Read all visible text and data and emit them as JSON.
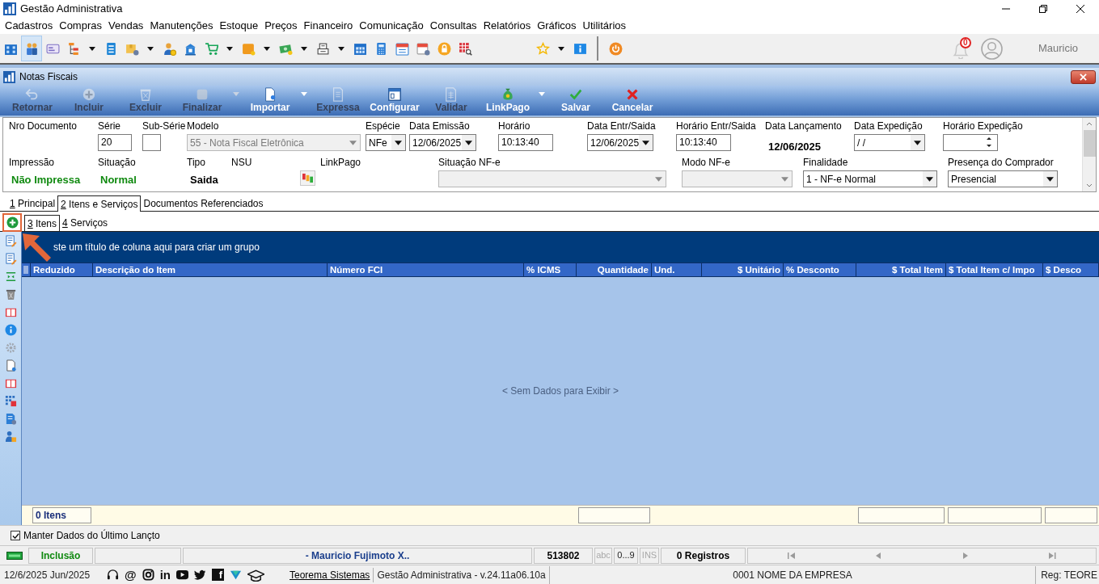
{
  "window": {
    "title": "Gestão Administrativa"
  },
  "menu": [
    "Cadastros",
    "Compras",
    "Vendas",
    "Manutenções",
    "Estoque",
    "Preços",
    "Financeiro",
    "Comunicação",
    "Consultas",
    "Relatórios",
    "Gráficos",
    "Utilitários"
  ],
  "quick_toolbar": [
    {
      "dropdown": false,
      "selected": false
    },
    {
      "dropdown": false,
      "selected": true
    },
    {
      "dropdown": false,
      "selected": false
    },
    {
      "dropdown": true,
      "selected": false
    },
    {
      "dropdown": false,
      "selected": false
    },
    {
      "dropdown": true,
      "selected": false
    },
    {
      "dropdown": false,
      "selected": false
    },
    {
      "dropdown": false,
      "selected": false
    },
    {
      "dropdown": true,
      "selected": false
    },
    {
      "dropdown": true,
      "selected": false
    },
    {
      "dropdown": true,
      "selected": false
    },
    {
      "dropdown": true,
      "selected": false
    },
    {
      "dropdown": false,
      "selected": false
    },
    {
      "dropdown": false,
      "selected": false
    },
    {
      "dropdown": false,
      "selected": false
    },
    {
      "dropdown": false,
      "selected": false
    },
    {
      "dropdown": false,
      "selected": false
    },
    {
      "dropdown": false,
      "selected": false
    },
    {
      "dropdown": true,
      "selected": false
    },
    {
      "dropdown": false,
      "selected": false
    },
    {
      "dropdown": false,
      "selected": false
    }
  ],
  "notifications": {
    "count": "0"
  },
  "user": {
    "name": "Mauricio"
  },
  "document_window": {
    "title": "Notas Fiscais",
    "actions": [
      {
        "label": "Retornar",
        "disabled": true,
        "dropdown": false
      },
      {
        "label": "Incluir",
        "disabled": true,
        "dropdown": false
      },
      {
        "label": "Excluir",
        "disabled": true,
        "dropdown": false
      },
      {
        "label": "Finalizar",
        "disabled": true,
        "dropdown": true
      },
      {
        "label": "Importar",
        "disabled": false,
        "dropdown": true
      },
      {
        "label": "Expressa",
        "disabled": true,
        "dropdown": false
      },
      {
        "label": "Configurar",
        "disabled": false,
        "dropdown": false
      },
      {
        "label": "Validar",
        "disabled": true,
        "dropdown": false
      },
      {
        "label": "LinkPago",
        "disabled": false,
        "dropdown": true
      },
      {
        "label": "Salvar",
        "disabled": false,
        "dropdown": false
      },
      {
        "label": "Cancelar",
        "disabled": false,
        "dropdown": false
      }
    ],
    "header_rows": [
      [
        {
          "label": "Nro Documento",
          "kind": "none"
        },
        {
          "label": "Série",
          "kind": "input",
          "value": "20"
        },
        {
          "label": "Sub-Série",
          "kind": "input"
        },
        {
          "label": "Modelo",
          "kind": "select",
          "value": "55 - Nota Fiscal Eletrônica",
          "disabled": true
        },
        {
          "label": "Espécie",
          "kind": "select",
          "value": "NFe",
          "disabled": false
        },
        {
          "label": "Data Emissão",
          "kind": "select",
          "value": "12/06/2025",
          "disabled": false
        },
        {
          "label": "Horário",
          "kind": "input",
          "value": "10:13:40"
        },
        {
          "label": "Data Entr/Saida",
          "kind": "select",
          "value": "12/06/2025",
          "disabled": false
        },
        {
          "label": "Horário Entr/Saida",
          "kind": "input",
          "value": "10:13:40"
        },
        {
          "label": "Data Lançamento",
          "kind": "text",
          "value": "12/06/2025"
        },
        {
          "label": "Data Expedição",
          "kind": "select",
          "value": "/ /",
          "disabled": false
        },
        {
          "label": "Horário Expedição",
          "kind": "spin"
        }
      ],
      [
        {
          "label": "Impressão",
          "kind": "status",
          "value": "Não Impressa"
        },
        {
          "label": "Situação",
          "kind": "status",
          "value": "Normal"
        },
        {
          "label": "Tipo",
          "kind": "text",
          "value": "Saida"
        },
        {
          "label": "NSU",
          "kind": "button"
        },
        {
          "label": "LinkPago",
          "kind": "none"
        },
        {
          "label": "Situação NF-e",
          "kind": "select",
          "disabled": true
        },
        {
          "label": "Modo NF-e",
          "kind": "select",
          "disabled": true
        },
        {
          "label": "Finalidade",
          "kind": "select",
          "value": "1 - NF-e Normal",
          "disabled": false
        },
        {
          "label": "Presença do Comprador",
          "kind": "select",
          "value": "Presencial",
          "disabled": false
        }
      ]
    ],
    "tabs": [
      {
        "key": "1",
        "label": "Principal",
        "selected": false
      },
      {
        "key": "2",
        "label": "Itens e Serviços",
        "selected": true
      },
      {
        "label": "Documentos Referenciados",
        "selected": false
      }
    ],
    "subtabs": [
      {
        "key": "3",
        "label": "Itens",
        "selected": true
      },
      {
        "key": "4",
        "label": "Serviços",
        "selected": false
      }
    ],
    "grid": {
      "group_hint": "ste um título de coluna aqui para criar um grupo",
      "columns": [
        {
          "title": "Reduzido",
          "summary": "0 Itens",
          "summary_box": true
        },
        {
          "title": "Descrição do Item",
          "summary_box": false
        },
        {
          "title": "Número FCI",
          "summary_box": false
        },
        {
          "title": "% ICMS",
          "summary_box": false
        },
        {
          "title": "Quantidade",
          "summary_box": true
        },
        {
          "title": "Und.",
          "summary_box": false
        },
        {
          "title": "$ Unitário",
          "summary_box": false
        },
        {
          "title": "% Desconto",
          "summary_box": false
        },
        {
          "title": "$ Total Item",
          "summary_box": true
        },
        {
          "title": "$ Total Item c/ Impo",
          "summary_box": true
        },
        {
          "title": "$ Desco",
          "summary_box": true
        }
      ],
      "empty_text": "< Sem Dados para Exibir >"
    },
    "keep_data": {
      "label": "Manter Dados do Último Lançto",
      "checked": true
    }
  },
  "status_bar": {
    "mode": "Inclusão",
    "operator": "- Mauricio Fujimoto X..",
    "number": "513802",
    "indicators": [
      {
        "text": "abc",
        "on": false
      },
      {
        "text": "0...9",
        "on": true
      },
      {
        "text": "INS",
        "on": false
      }
    ],
    "records": "0 Registros"
  },
  "bottom_bar": {
    "date": "12/6/2025 Jun/2025",
    "links": [
      {
        "kind": "headset"
      },
      {
        "kind": "glyph",
        "text": "@"
      },
      {
        "kind": "camera"
      },
      {
        "kind": "glyph",
        "text": "in"
      },
      {
        "kind": "play"
      },
      {
        "kind": "bird"
      },
      {
        "kind": "boxed",
        "text": "f"
      },
      {
        "kind": "logo"
      },
      {
        "kind": "cap"
      }
    ],
    "company_link": "Teorema Sistemas",
    "version": "Gestão Administrativa - v.24.11a06.10a",
    "company": "0001 NOME DA EMPRESA",
    "registration": "Reg: TEORE"
  }
}
